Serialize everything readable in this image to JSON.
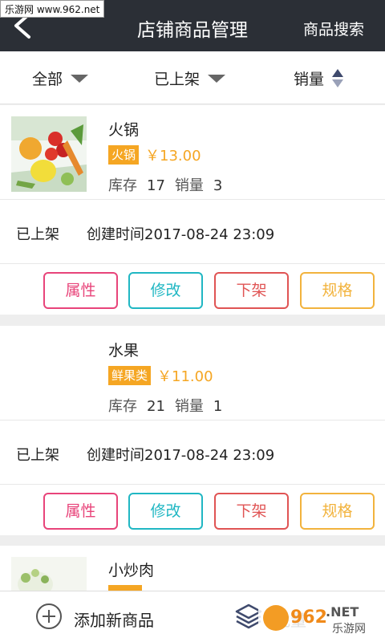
{
  "watermark_top": "乐游网 www.962.net",
  "header": {
    "title": "店铺商品管理",
    "search_label": "商品搜索"
  },
  "filters": [
    {
      "label": "全部"
    },
    {
      "label": "已上架"
    },
    {
      "label": "销量"
    }
  ],
  "products": [
    {
      "name": "火锅",
      "tag": "火锅",
      "price": "￥13.00",
      "stock_label": "库存",
      "stock": "17",
      "sales_label": "销量",
      "sales": "3",
      "status": "已上架",
      "created": "创建时间2017-08-24 23:09",
      "has_image": true
    },
    {
      "name": "水果",
      "tag": "鲜果类",
      "price": "￥11.00",
      "stock_label": "库存",
      "stock": "21",
      "sales_label": "销量",
      "sales": "1",
      "status": "已上架",
      "created": "创建时间2017-08-24 23:09",
      "has_image": false
    },
    {
      "name": "小炒肉",
      "has_image": true
    }
  ],
  "actions": {
    "attr": "属性",
    "edit": "修改",
    "off": "下架",
    "spec": "规格"
  },
  "bottom": {
    "add_label": "添加新商品",
    "batch_label": "批量"
  },
  "watermark_bottom": {
    "brand": "962",
    "suffix": ".NET",
    "sub": "乐游网"
  },
  "colors": {
    "header_bg": "#2b2f36",
    "price": "#f5a623",
    "attr": "#e8447a",
    "edit": "#20b7c3",
    "off": "#e05454",
    "spec": "#f2b33d"
  }
}
